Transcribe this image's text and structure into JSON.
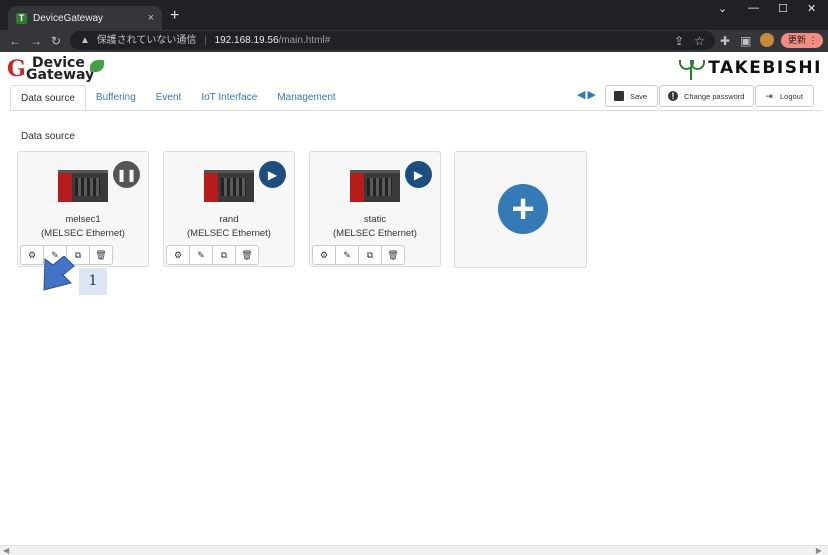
{
  "browser": {
    "tab_title": "DeviceGateway",
    "tab_close": "×",
    "new_tab": "+",
    "window_controls": [
      "⌄",
      "—",
      "☐",
      "✕"
    ],
    "nav": {
      "back": "←",
      "forward": "→",
      "reload": "↻"
    },
    "address": {
      "warning_icon": "▲",
      "insecure_label": "保護されていない通信",
      "separator": "|",
      "host": "192.168.19.56",
      "path": "/main.html#"
    },
    "toolbar_icons": [
      "share-icon",
      "star-icon",
      "extensions-icon",
      "sidebar-icon"
    ],
    "update_label": "更新"
  },
  "app": {
    "logo": {
      "mark": "G",
      "line1": "Device",
      "line2": "Gateway"
    },
    "brand": "TAKEBISHI",
    "tabs": [
      {
        "label": "Data source",
        "active": true
      },
      {
        "label": "Buffering",
        "active": false
      },
      {
        "label": "Event",
        "active": false
      },
      {
        "label": "IoT Interface",
        "active": false
      },
      {
        "label": "Management",
        "active": false
      }
    ],
    "arrows": {
      "left": "◀",
      "right": "▶"
    },
    "buttons": {
      "save": "Save",
      "change_password": "Change password",
      "logout": "Logout"
    },
    "section_title": "Data source",
    "cards": [
      {
        "name": "melsec1",
        "protocol": "(MELSEC Ethernet)",
        "state": "paused",
        "state_glyph": "❚❚"
      },
      {
        "name": "rand",
        "protocol": "(MELSEC Ethernet)",
        "state": "running",
        "state_glyph": "▶"
      },
      {
        "name": "static",
        "protocol": "(MELSEC Ethernet)",
        "state": "running",
        "state_glyph": "▶"
      }
    ],
    "card_actions": {
      "settings": "⚙",
      "edit": "✎",
      "copy": "⧉",
      "delete": "🗑"
    },
    "add_glyph": "+"
  },
  "annotation": {
    "callout_number": "1"
  },
  "colors": {
    "accent": "#337ab7",
    "play": "#1c4f80",
    "pause": "#555555",
    "brand_green": "#2e7d32"
  }
}
